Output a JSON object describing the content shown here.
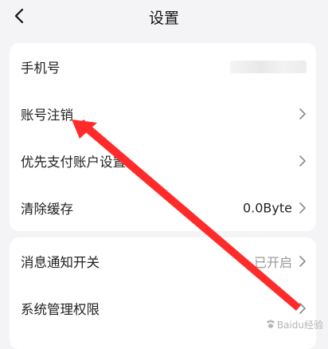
{
  "header": {
    "title": "设置",
    "back_icon": "chevron-left-icon"
  },
  "card1": {
    "rows": [
      {
        "label": "手机号",
        "value": "",
        "has_chevron": false
      },
      {
        "label": "账号注销",
        "value": "",
        "has_chevron": true
      },
      {
        "label": "优先支付账户设置",
        "value": "",
        "has_chevron": true
      },
      {
        "label": "清除缓存",
        "value": "0.0Byte",
        "has_chevron": true
      }
    ]
  },
  "card2": {
    "rows": [
      {
        "label": "消息通知开关",
        "value": "已开启",
        "has_chevron": true
      },
      {
        "label": "系统管理权限",
        "value": "",
        "has_chevron": true
      }
    ]
  },
  "annotation": {
    "color": "#ff2b2b",
    "icon": "red-arrow-annotation"
  },
  "watermark": {
    "text": "Baidu经验"
  },
  "colors": {
    "background": "#f4f4f6",
    "card": "#ffffff",
    "muted_value": "#9a9a9a",
    "arrow": "#ff2b2b"
  }
}
